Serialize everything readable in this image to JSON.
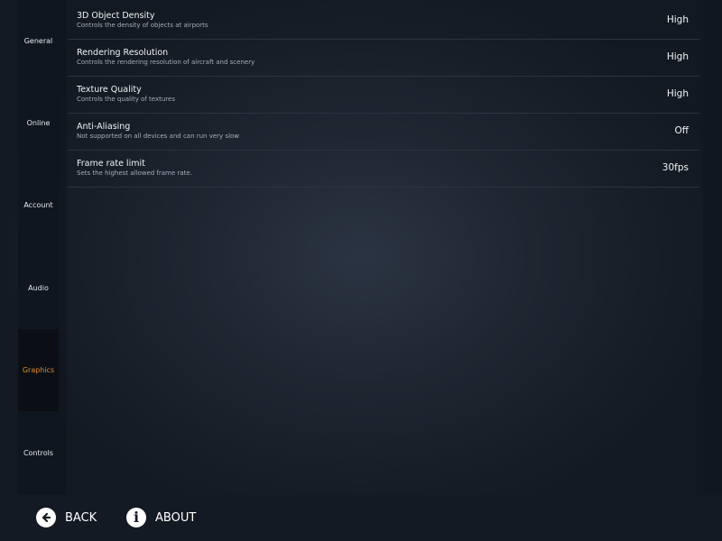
{
  "sidebar": {
    "items": [
      {
        "label": "General"
      },
      {
        "label": "Online"
      },
      {
        "label": "Account"
      },
      {
        "label": "Audio"
      },
      {
        "label": "Graphics",
        "active": true
      },
      {
        "label": "Controls"
      }
    ]
  },
  "settings": [
    {
      "title": "3D Object Density",
      "description": "Controls the density of objects at airports",
      "value": "High"
    },
    {
      "title": "Rendering Resolution",
      "description": "Controls the rendering resolution of aircraft and scenery",
      "value": "High"
    },
    {
      "title": "Texture Quality",
      "description": "Controls the quality of textures",
      "value": "High"
    },
    {
      "title": "Anti-Aliasing",
      "description": "Not supported on all devices and can run very slow",
      "value": "Off"
    },
    {
      "title": "Frame rate limit",
      "description": "Sets the highest allowed frame rate.",
      "value": "30fps"
    }
  ],
  "footer": {
    "back_label": "BACK",
    "about_label": "ABOUT",
    "back_icon": "arrow-left-circle-icon",
    "about_icon": "info-circle-icon"
  },
  "colors": {
    "accent": "#e58a2c",
    "background": "#1e2631",
    "text": "#f1f3f6"
  }
}
